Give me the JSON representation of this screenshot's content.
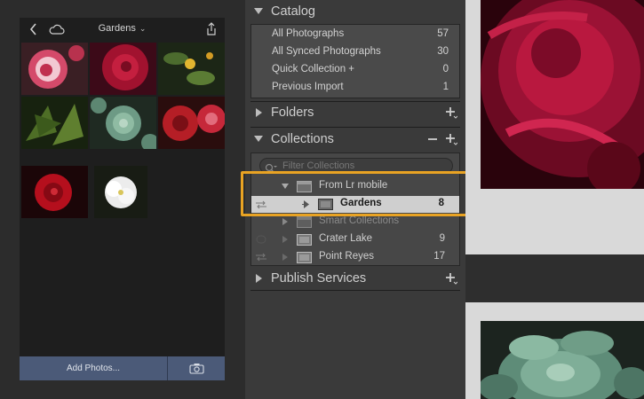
{
  "mobile": {
    "album_title": "Gardens",
    "add_photos_label": "Add Photos...",
    "icons": [
      "back-icon",
      "cloud-icon",
      "chevron-down-icon",
      "share-icon",
      "camera-icon"
    ]
  },
  "lightroom": {
    "catalog": {
      "title": "Catalog",
      "items": [
        {
          "name": "All Photographs",
          "count": "57"
        },
        {
          "name": "All Synced Photographs",
          "count": "30"
        },
        {
          "name": "Quick Collection  +",
          "count": "0"
        },
        {
          "name": "Previous Import",
          "count": "1"
        }
      ]
    },
    "folders": {
      "title": "Folders"
    },
    "collections": {
      "title": "Collections",
      "filter_placeholder": "Filter Collections",
      "items": [
        {
          "name": "From Lr mobile",
          "count": ""
        },
        {
          "name": "Gardens",
          "count": "8"
        },
        {
          "name": "Smart Collections",
          "count": ""
        },
        {
          "name": "Crater Lake",
          "count": "9"
        },
        {
          "name": "Point Reyes",
          "count": "17"
        }
      ]
    },
    "publish_services": {
      "title": "Publish Services"
    }
  },
  "colors": {
    "highlight": "#e9a323",
    "add_bar": "#4b5a78",
    "panel": "#3a3a3a"
  }
}
